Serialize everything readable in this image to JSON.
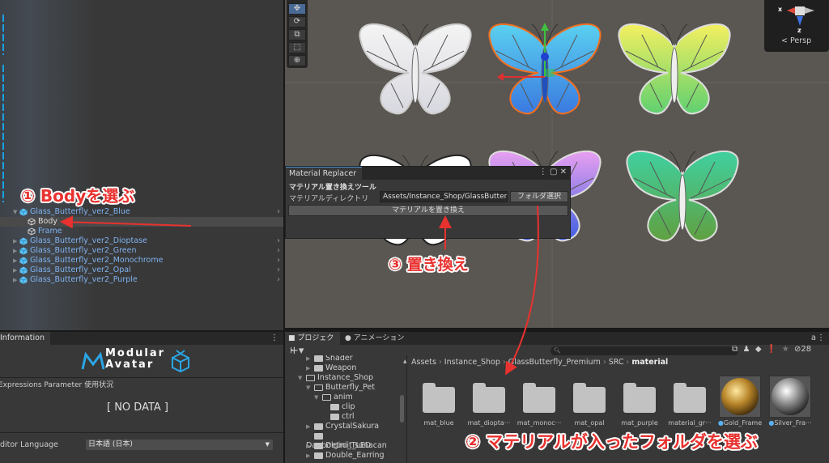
{
  "hierarchy": {
    "items": [
      {
        "label": "Glass_Butterfly_ver2_Blue",
        "expanded": true
      },
      {
        "label": "Body",
        "child": true,
        "selected": true
      },
      {
        "label": "Frame",
        "child": true
      },
      {
        "label": "Glass_Butterfly_ver2_Dioptase"
      },
      {
        "label": "Glass_Butterfly_ver2_Green"
      },
      {
        "label": "Glass_Butterfly_ver2_Monochrome"
      },
      {
        "label": "Glass_Butterfly_ver2_Opal"
      },
      {
        "label": "Glass_Butterfly_ver2_Purple"
      }
    ]
  },
  "scene": {
    "persp_label": "< Persp",
    "axis_x": "x",
    "axis_z": "z",
    "tools": [
      "move-tool",
      "rotate-tool",
      "scale-tool",
      "rect-tool",
      "transform-tool"
    ]
  },
  "material_replacer": {
    "tab": "Material Replacer",
    "heading": "マテリアル置き換えツール",
    "dir_label": "マテリアルディレクトリ",
    "dir_value": "Assets/Instance_Shop/GlassButterfl",
    "folder_button": "フォルダ選択",
    "replace_button": "マテリアルを置き換え"
  },
  "info": {
    "tab": "Information",
    "logo_line1": "Modular",
    "logo_line2": "Avatar",
    "expr_label": "Expressions Parameter 使用状況",
    "no_data": "[ NO DATA ]",
    "lang_label": "Editor Language",
    "lang_value": "日本語 (日本)"
  },
  "project": {
    "tabs": [
      "プロジェクト",
      "アニメーション"
    ],
    "hidden_count": "28",
    "breadcrumb": [
      "Assets",
      "Instance_Shop",
      "GlassButterfly_Premium",
      "SRC",
      "material"
    ],
    "tree": [
      {
        "label": "Shader",
        "depth": 1,
        "arrow": "▶"
      },
      {
        "label": "Weapon",
        "depth": 1,
        "arrow": "▶"
      },
      {
        "label": "Instance_Shop",
        "depth": 0,
        "arrow": "▼"
      },
      {
        "label": "Butterfly_Pet",
        "depth": 1,
        "arrow": "▼"
      },
      {
        "label": "anim",
        "depth": 2,
        "arrow": "▼"
      },
      {
        "label": "clip",
        "depth": 3,
        "arrow": ""
      },
      {
        "label": "ctrl",
        "depth": 3,
        "arrow": ""
      },
      {
        "label": "CrystalSakura",
        "depth": 1,
        "arrow": "▶"
      },
      {
        "label": "Danbolgini_Tsunacan",
        "depth": 1,
        "arrow": ""
      },
      {
        "label": "Detroit_LED",
        "depth": 1,
        "arrow": "▶"
      },
      {
        "label": "Double_Earring",
        "depth": 1,
        "arrow": "▶"
      }
    ],
    "assets": [
      {
        "label": "mat_blue",
        "type": "folder"
      },
      {
        "label": "mat_diopta···",
        "type": "folder"
      },
      {
        "label": "mat_monoc···",
        "type": "folder"
      },
      {
        "label": "mat_opal",
        "type": "folder"
      },
      {
        "label": "mat_purple",
        "type": "folder"
      },
      {
        "label": "material_gr···",
        "type": "folder"
      },
      {
        "label": "Gold_Frame",
        "type": "material"
      },
      {
        "label": "Silver_Fra···",
        "type": "material"
      }
    ]
  },
  "annotations": {
    "step1": "① Bodyを選ぶ",
    "step2": "② マテリアルが入ったフォルダを選ぶ",
    "step3": "③ 置き換え"
  }
}
